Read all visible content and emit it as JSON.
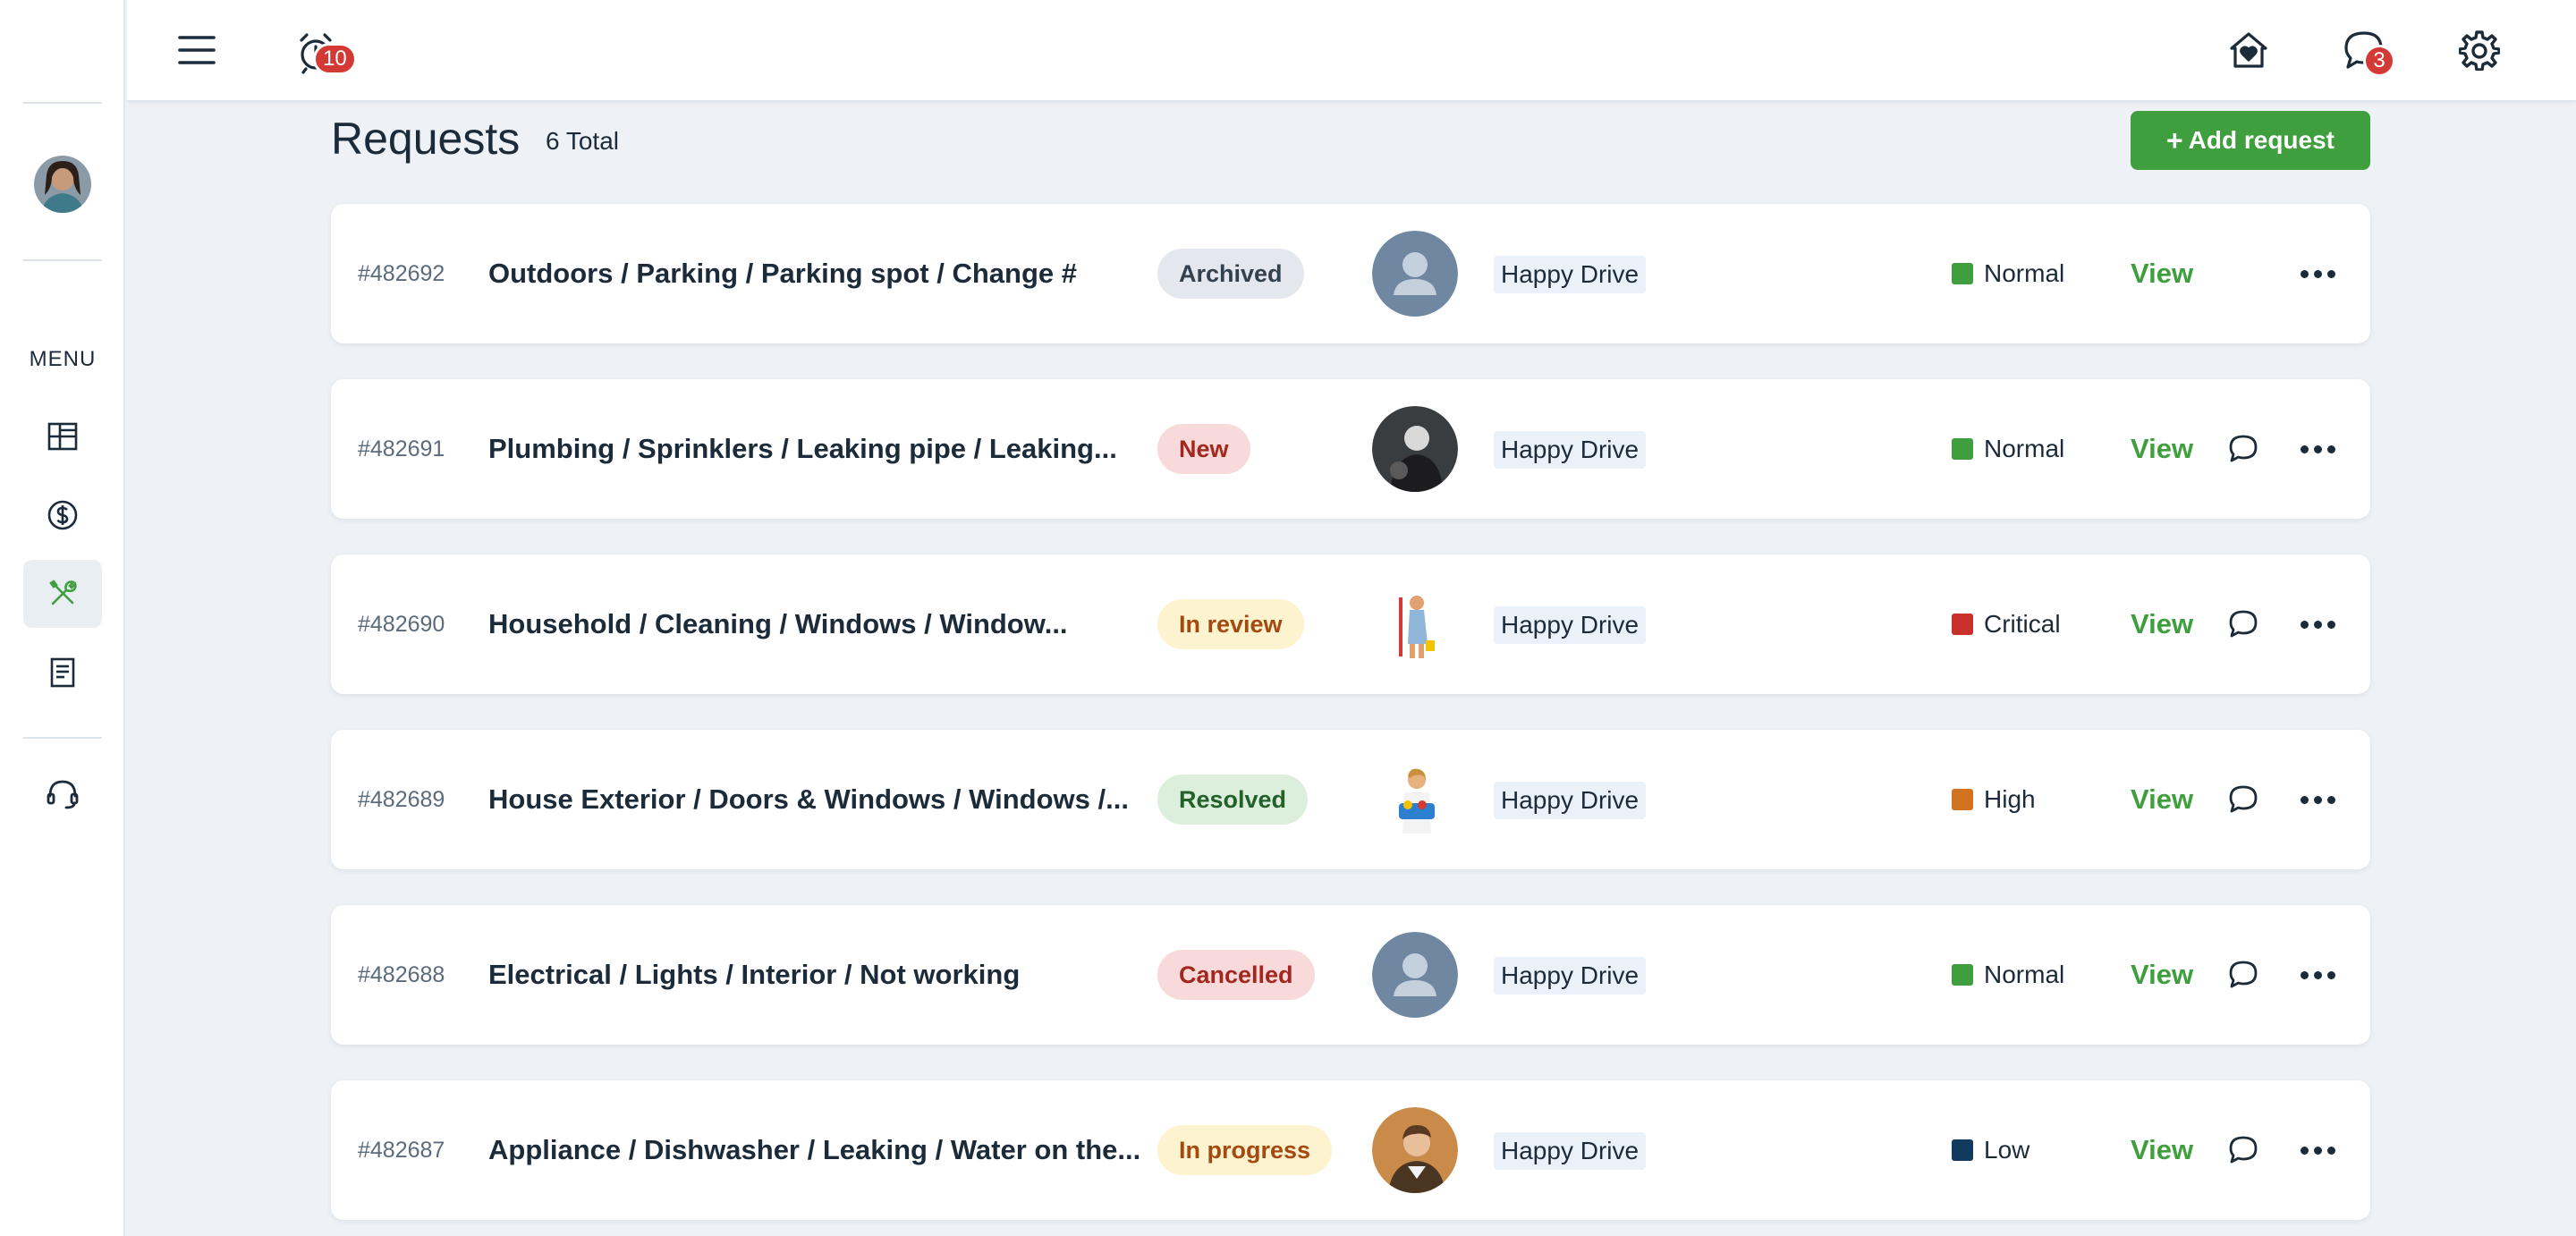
{
  "sidebar": {
    "menu_label": "MENU",
    "items": [
      {
        "icon": "dashboard-icon"
      },
      {
        "icon": "dollar-circle-icon"
      },
      {
        "icon": "tools-icon",
        "active": true
      },
      {
        "icon": "document-icon"
      }
    ],
    "support_icon": "headset-icon"
  },
  "topbar": {
    "alarm_badge": "10",
    "messages_badge": "3"
  },
  "page": {
    "title": "Requests",
    "total": "6 Total",
    "add_button": "Add request"
  },
  "colors": {
    "accent": "#3f9f3f",
    "badge": "#d43a35"
  },
  "requests": [
    {
      "id": "#482692",
      "title": "Outdoors / Parking / Parking spot / Change #",
      "status": "Archived",
      "avatar": "placeholder",
      "property": "Happy Drive",
      "priority": "Normal",
      "priority_color": "#3f9f3f",
      "view": "View",
      "has_chat": false
    },
    {
      "id": "#482691",
      "title": "Plumbing / Sprinklers / Leaking pipe / Leaking...",
      "status": "New",
      "avatar": "photo-dark",
      "property": "Happy Drive",
      "priority": "Normal",
      "priority_color": "#3f9f3f",
      "view": "View",
      "has_chat": true
    },
    {
      "id": "#482690",
      "title": "Household / Cleaning / Windows / Window...",
      "status": "In review",
      "avatar": "cleaner",
      "property": "Happy Drive",
      "priority": "Critical",
      "priority_color": "#c8302c",
      "view": "View",
      "has_chat": true
    },
    {
      "id": "#482689",
      "title": "House Exterior / Doors & Windows / Windows /...",
      "status": "Resolved",
      "avatar": "cleaner-2",
      "property": "Happy Drive",
      "priority": "High",
      "priority_color": "#d2731f",
      "view": "View",
      "has_chat": true
    },
    {
      "id": "#482688",
      "title": "Electrical / Lights / Interior / Not working",
      "status": "Cancelled",
      "avatar": "placeholder",
      "property": "Happy Drive",
      "priority": "Normal",
      "priority_color": "#3f9f3f",
      "view": "View",
      "has_chat": true
    },
    {
      "id": "#482687",
      "title": "Appliance / Dishwasher / Leaking / Water on the...",
      "status": "In progress",
      "avatar": "photo-man",
      "property": "Happy Drive",
      "priority": "Low",
      "priority_color": "#12395e",
      "view": "View",
      "has_chat": true
    }
  ]
}
